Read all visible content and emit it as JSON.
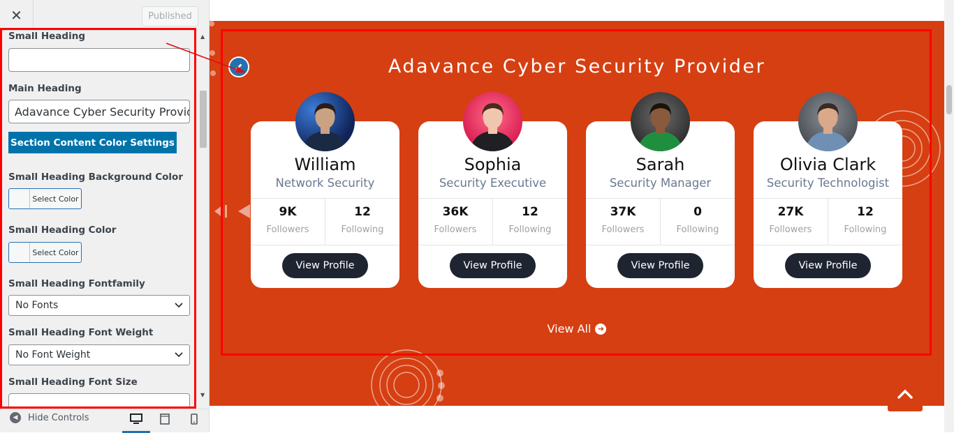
{
  "sidebar": {
    "close_symbol": "✕",
    "publish_label": "Published",
    "fields": {
      "small_heading": {
        "label": "Small Heading",
        "value": ""
      },
      "main_heading": {
        "label": "Main Heading",
        "value": "Adavance Cyber Security Provider"
      },
      "content_color_button": "Section Content Color Settings",
      "small_heading_bg_color": {
        "label": "Small Heading Background Color",
        "button": "Select Color"
      },
      "small_heading_color": {
        "label": "Small Heading Color",
        "button": "Select Color"
      },
      "small_heading_fontfamily": {
        "label": "Small Heading Fontfamily",
        "value": "No Fonts"
      },
      "small_heading_font_weight": {
        "label": "Small Heading Font Weight",
        "value": "No Font Weight"
      },
      "small_heading_font_size": {
        "label": "Small Heading Font Size"
      }
    },
    "footer": {
      "hide_controls": "Hide Controls",
      "devices": [
        "desktop-icon",
        "tablet-icon",
        "mobile-icon"
      ]
    }
  },
  "preview": {
    "section_title": "Adavance Cyber Security Provider",
    "accent_color": "#d63f12",
    "cards": [
      {
        "name": "William",
        "role": "Network Security",
        "followers": "9K",
        "followers_label": "Followers",
        "following": "12",
        "following_label": "Following",
        "button": "View Profile"
      },
      {
        "name": "Sophia",
        "role": "Security Executive",
        "followers": "36K",
        "followers_label": "Followers",
        "following": "12",
        "following_label": "Following",
        "button": "View Profile"
      },
      {
        "name": "Sarah",
        "role": "Security Manager",
        "followers": "37K",
        "followers_label": "Followers",
        "following": "0",
        "following_label": "Following",
        "button": "View Profile"
      },
      {
        "name": "Olivia Clark",
        "role": "Security Technologist",
        "followers": "27K",
        "followers_label": "Followers",
        "following": "12",
        "following_label": "Following",
        "button": "View Profile"
      }
    ],
    "view_all": "View All"
  }
}
